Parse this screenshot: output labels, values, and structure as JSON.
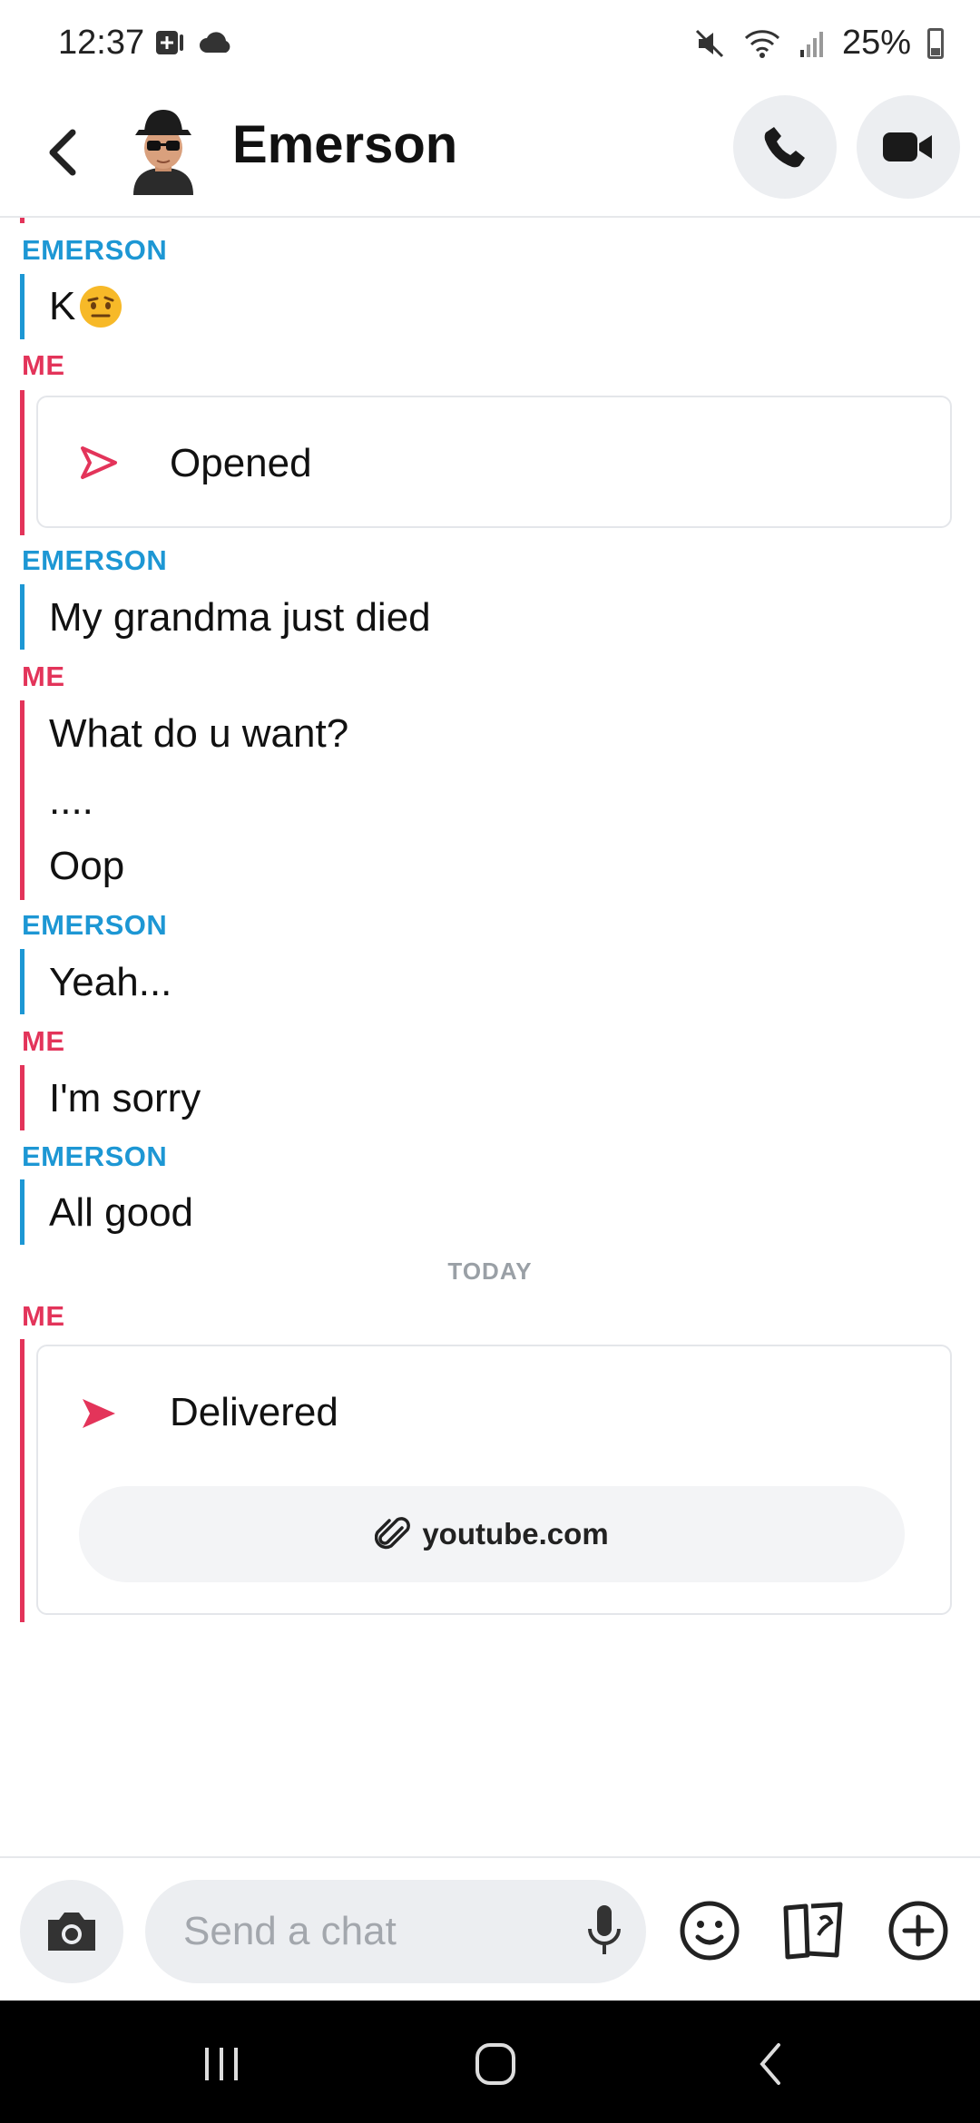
{
  "status_bar": {
    "time": "12:37",
    "battery": "25%"
  },
  "header": {
    "title": "Emerson"
  },
  "messages": {
    "g1_sender": "EMERSON",
    "g1_m1": "K",
    "g2_sender": "ME",
    "g2_card_status": "Opened",
    "g3_sender": "EMERSON",
    "g3_m1": "My grandma just died",
    "g4_sender": "ME",
    "g4_m1": "What do u want?",
    "g4_m2": "....",
    "g4_m3": "Oop",
    "g5_sender": "EMERSON",
    "g5_m1": "Yeah...",
    "g6_sender": "ME",
    "g6_m1": "I'm sorry",
    "g7_sender": "EMERSON",
    "g7_m1": "All good",
    "date_separator": "TODAY",
    "g8_sender": "ME",
    "g8_card_status": "Delivered",
    "g8_link": "youtube.com"
  },
  "composer": {
    "placeholder": "Send a chat"
  },
  "colors": {
    "them": "#1d97d4",
    "me": "#e3345a"
  }
}
